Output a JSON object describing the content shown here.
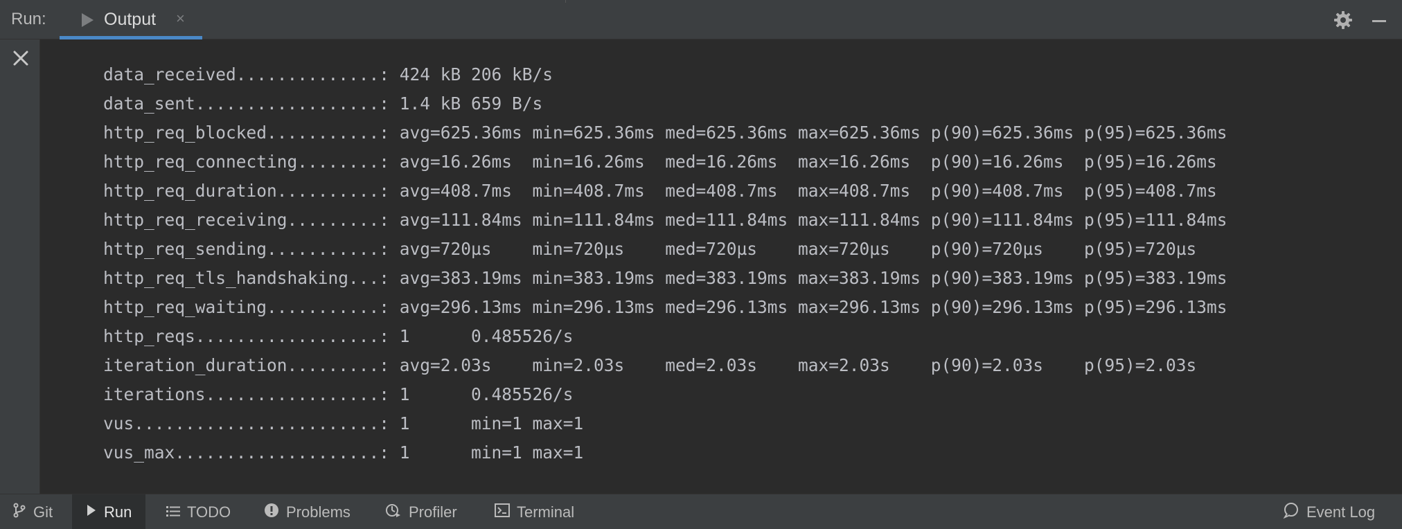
{
  "header": {
    "run_label": "Run:",
    "tab_label": "Output",
    "tab_close": "×"
  },
  "console": {
    "lines": [
      "data_received..............: 424 kB 206 kB/s",
      "data_sent..................: 1.4 kB 659 B/s",
      "http_req_blocked...........: avg=625.36ms min=625.36ms med=625.36ms max=625.36ms p(90)=625.36ms p(95)=625.36ms",
      "http_req_connecting........: avg=16.26ms  min=16.26ms  med=16.26ms  max=16.26ms  p(90)=16.26ms  p(95)=16.26ms",
      "http_req_duration..........: avg=408.7ms  min=408.7ms  med=408.7ms  max=408.7ms  p(90)=408.7ms  p(95)=408.7ms",
      "http_req_receiving.........: avg=111.84ms min=111.84ms med=111.84ms max=111.84ms p(90)=111.84ms p(95)=111.84ms",
      "http_req_sending...........: avg=720µs    min=720µs    med=720µs    max=720µs    p(90)=720µs    p(95)=720µs",
      "http_req_tls_handshaking...: avg=383.19ms min=383.19ms med=383.19ms max=383.19ms p(90)=383.19ms p(95)=383.19ms",
      "http_req_waiting...........: avg=296.13ms min=296.13ms med=296.13ms max=296.13ms p(90)=296.13ms p(95)=296.13ms",
      "http_reqs..................: 1      0.485526/s",
      "iteration_duration.........: avg=2.03s    min=2.03s    med=2.03s    max=2.03s    p(90)=2.03s    p(95)=2.03s",
      "iterations.................: 1      0.485526/s",
      "vus........................: 1      min=1 max=1",
      "vus_max....................: 1      min=1 max=1"
    ]
  },
  "toolbar": {
    "git": "Git",
    "run": "Run",
    "todo": "TODO",
    "problems": "Problems",
    "profiler": "Profiler",
    "terminal": "Terminal",
    "event_log": "Event Log"
  },
  "icons": {
    "tab_play": "play-icon",
    "settings": "gear-icon",
    "minimize": "minimize-icon",
    "stop": "close-icon",
    "git": "git-branch-icon",
    "run": "play-icon",
    "todo": "list-icon",
    "problems": "warning-icon",
    "profiler": "profiler-icon",
    "terminal": "terminal-icon",
    "event_log": "speech-bubble-icon"
  },
  "colors": {
    "accent": "#4a88c7",
    "background": "#2b2b2b",
    "panel": "#3c3f41",
    "text": "#bcbec4"
  }
}
